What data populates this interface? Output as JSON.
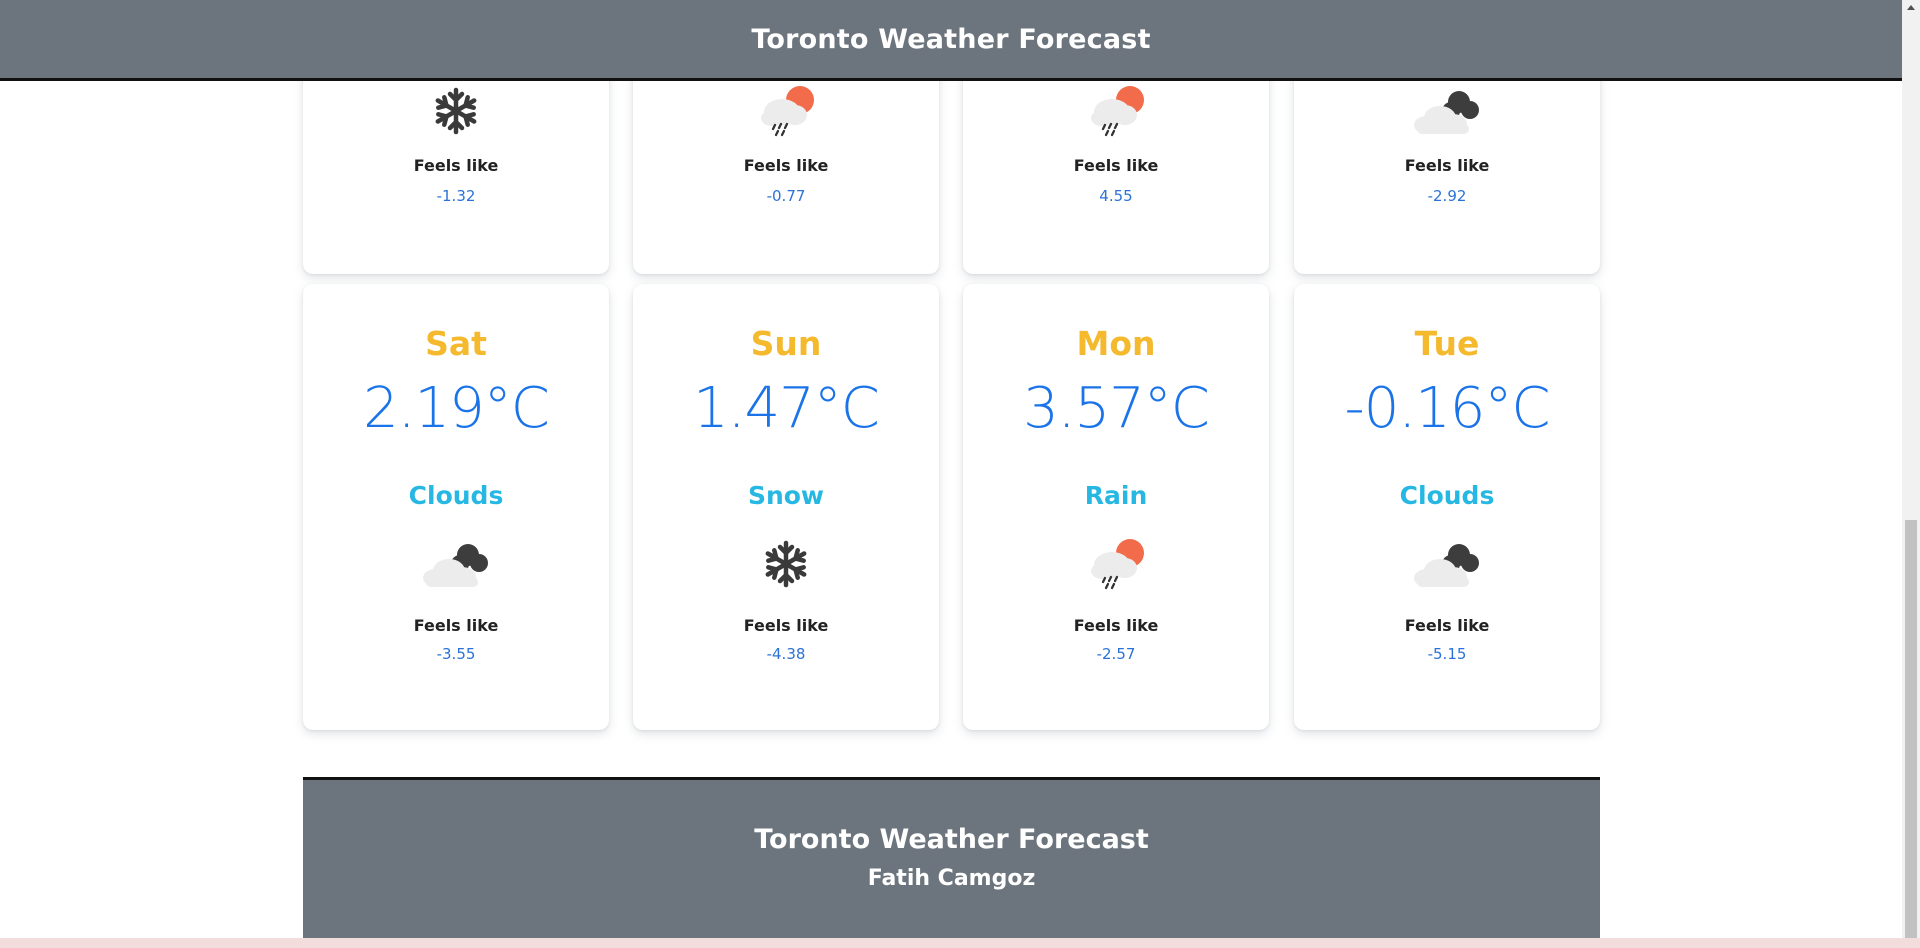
{
  "header": {
    "title": "Toronto Weather Forecast"
  },
  "row1": [
    {
      "icon": "snowflake-icon",
      "feels_label": "Feels like",
      "feels_value": "-1.32"
    },
    {
      "icon": "sun-cloud-rain-icon",
      "feels_label": "Feels like",
      "feels_value": "-0.77"
    },
    {
      "icon": "sun-cloud-rain-icon",
      "feels_label": "Feels like",
      "feels_value": "4.55"
    },
    {
      "icon": "clouds-icon",
      "feels_label": "Feels like",
      "feels_value": "-2.92"
    }
  ],
  "row2": [
    {
      "day": "Sat",
      "temp": "2.19°C",
      "condition": "Clouds",
      "icon": "clouds-icon",
      "feels_label": "Feels like",
      "feels_value": "-3.55"
    },
    {
      "day": "Sun",
      "temp": "1.47°C",
      "condition": "Snow",
      "icon": "snowflake-icon",
      "feels_label": "Feels like",
      "feels_value": "-4.38"
    },
    {
      "day": "Mon",
      "temp": "3.57°C",
      "condition": "Rain",
      "icon": "sun-cloud-rain-icon",
      "feels_label": "Feels like",
      "feels_value": "-2.57"
    },
    {
      "day": "Tue",
      "temp": "-0.16°C",
      "condition": "Clouds",
      "icon": "clouds-icon",
      "feels_label": "Feels like",
      "feels_value": "-5.15"
    }
  ],
  "footer": {
    "title": "Toronto Weather Forecast",
    "author": "Fatih Camgoz"
  },
  "colors": {
    "header_bg": "#6c757d",
    "day": "#f4b92c",
    "temp": "#1a73e8",
    "condition": "#26b8e3",
    "feels_value": "#2b72d8"
  }
}
